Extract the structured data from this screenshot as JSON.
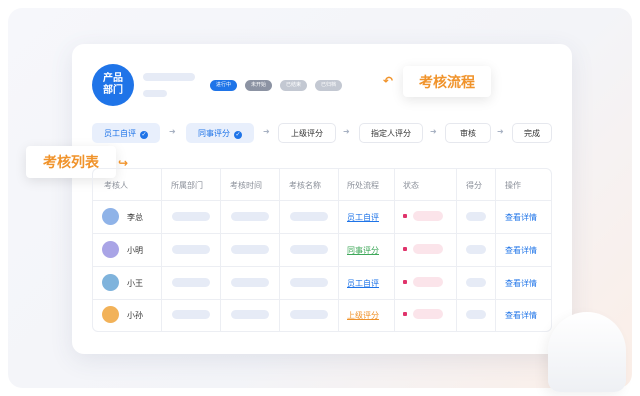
{
  "department": {
    "label": "产品\n部门"
  },
  "badges": [
    {
      "label": "进行中",
      "color": "#1f74e8"
    },
    {
      "label": "未开始",
      "color": "#8c93a3"
    },
    {
      "label": "已结束",
      "color": "#c3c8d2"
    },
    {
      "label": "已归档",
      "color": "#c3c8d2"
    }
  ],
  "callouts": {
    "flow": "考核流程",
    "list": "考核列表"
  },
  "steps": [
    {
      "label": "员工自评",
      "active": true
    },
    {
      "label": "同事评分",
      "active": true
    },
    {
      "label": "上级评分",
      "active": false
    },
    {
      "label": "指定人评分",
      "active": false
    },
    {
      "label": "审核",
      "active": false
    },
    {
      "label": "完成",
      "active": false
    }
  ],
  "table": {
    "headers": [
      "考核人",
      "所属部门",
      "考核时间",
      "考核名称",
      "所处流程",
      "状态",
      "得分",
      "操作"
    ],
    "rows": [
      {
        "name": "李总",
        "process": "员工自评",
        "process_color": "#1f74e8",
        "action": "查看详情",
        "avatar_color": "#8fb3e8"
      },
      {
        "name": "小明",
        "process": "同事评分",
        "process_color": "#3fa85a",
        "action": "查看详情",
        "avatar_color": "#a9a4e6"
      },
      {
        "name": "小王",
        "process": "员工自评",
        "process_color": "#1f74e8",
        "action": "查看详情",
        "avatar_color": "#7fb3dc"
      },
      {
        "name": "小孙",
        "process": "上级评分",
        "process_color": "#f0932b",
        "action": "查看详情",
        "avatar_color": "#f2b259"
      }
    ]
  }
}
